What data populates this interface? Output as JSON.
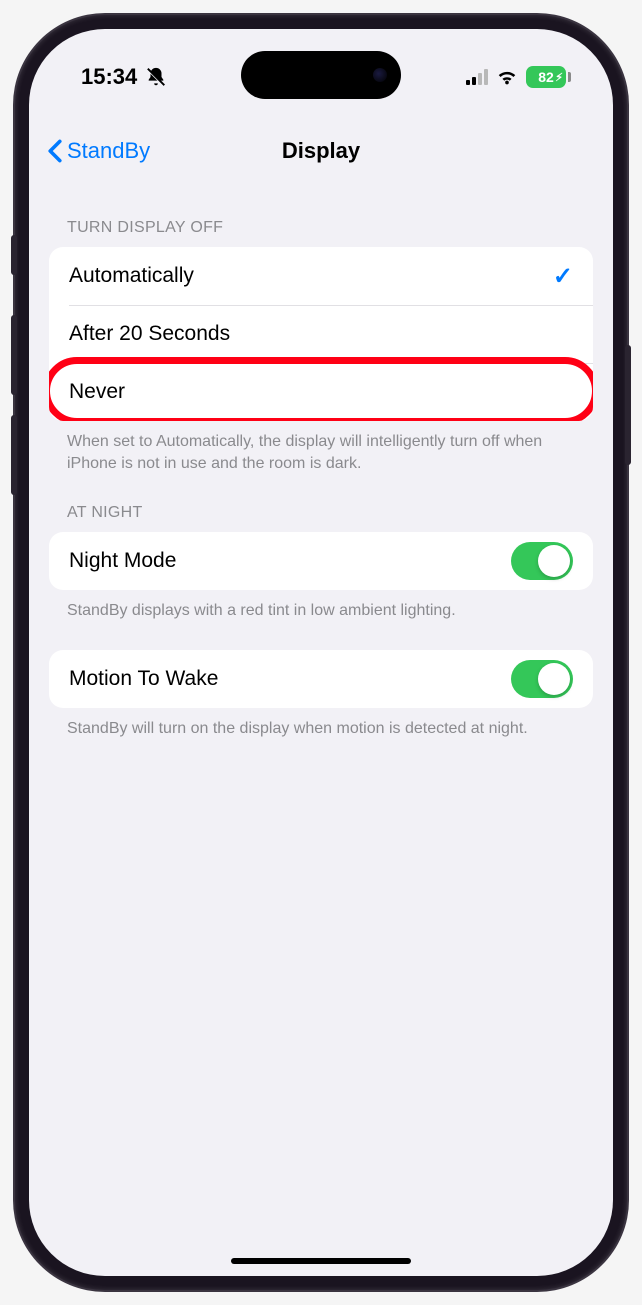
{
  "status": {
    "time": "15:34",
    "battery": "82"
  },
  "nav": {
    "back_label": "StandBy",
    "title": "Display"
  },
  "section1": {
    "header": "TURN DISPLAY OFF",
    "opt_auto": "Automatically",
    "opt_20s": "After 20 Seconds",
    "opt_never": "Never",
    "footer": "When set to Automatically, the display will intelligently turn off when iPhone is not in use and the room is dark."
  },
  "section2": {
    "header": "AT NIGHT",
    "night_mode": "Night Mode",
    "footer": "StandBy displays with a red tint in low ambient lighting."
  },
  "section3": {
    "motion": "Motion To Wake",
    "footer": "StandBy will turn on the display when motion is detected at night."
  }
}
